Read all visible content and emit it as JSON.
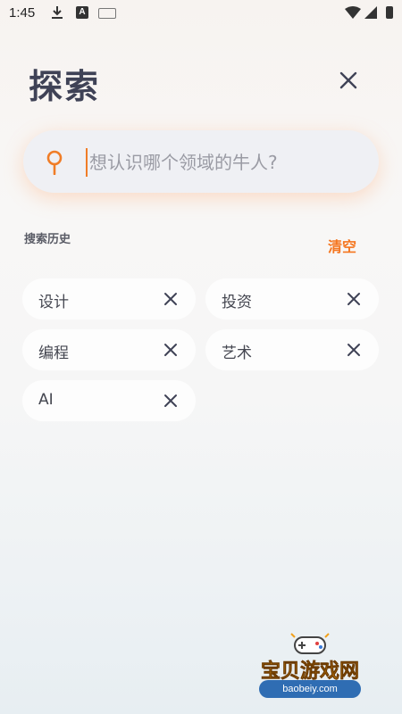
{
  "status_bar": {
    "time": "1:45",
    "a_badge": "A"
  },
  "header": {
    "title": "探索"
  },
  "search": {
    "placeholder": "想认识哪个领域的牛人?"
  },
  "history": {
    "label": "搜索历史",
    "clear_label": "清空",
    "items": [
      {
        "label": "设计"
      },
      {
        "label": "投资"
      },
      {
        "label": "编程"
      },
      {
        "label": "艺术"
      },
      {
        "label": "AI"
      }
    ]
  },
  "colors": {
    "accent": "#f5761f",
    "title": "#3f4256",
    "chip_bg": "#ffffff"
  },
  "watermark": {
    "name": "宝贝游戏网",
    "url": "baobeiy.com"
  }
}
